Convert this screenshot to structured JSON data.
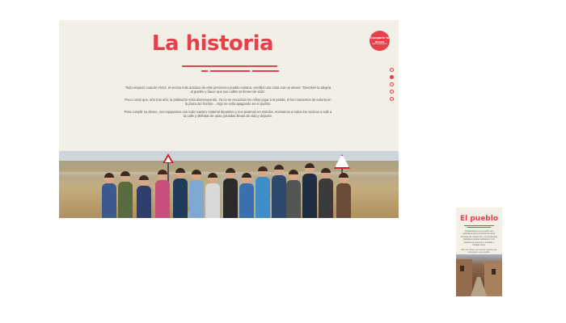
{
  "desktop": {
    "title": "La historia",
    "share_badge": {
      "line1": "Comparte tu deseo",
      "line2": "#deseosdeAmbi"
    },
    "nav_dots": [
      {
        "label": "section-1",
        "active": false
      },
      {
        "label": "section-2",
        "active": true
      },
      {
        "label": "section-3",
        "active": false
      },
      {
        "label": "section-4",
        "active": false
      },
      {
        "label": "section-5",
        "active": false
      }
    ],
    "paragraphs": [
      "Todo empezó cuando Víctor, el vecino más anciano de este pintoresco pueblo soriano, escribió una carta con un deseo: \"Devolver la alegría al pueblo y hacer que sus calles se llenen de vida\".",
      "Poco contó que, año tras año, la población solía disminuyendo. Ya no se escuchan los niños jugar a la pelota, ni los momentos de euforia en la plaza del frontón... Algo se solía apagando en el pueblo.",
      "Para cumplir su deseo, nos equipamos con todo nuestro material deportivo y nos pusimos en marcha. Animamos a todos los vecinos a salir a la calle y disfrutar de unas jornadas llenas de vida y deporte."
    ],
    "photo_alt": "group-of-hikers-photo"
  },
  "mobile": {
    "title": "El pueblo",
    "paragraphs": [
      "Quintanarejo es un pueblo con naturaleza de la provincia de Soria. Durante las vacaciones, sus pequeñas barriadas pierden habitantes y los jóvenes se marchan a estudiar o trabajar fuera.",
      "Allí vive Víctor, uno de los vecinos que más quiere a su pueblo."
    ]
  },
  "colors": {
    "accent": "#e6404a",
    "background": "#f2efe6",
    "text": "#555555"
  }
}
